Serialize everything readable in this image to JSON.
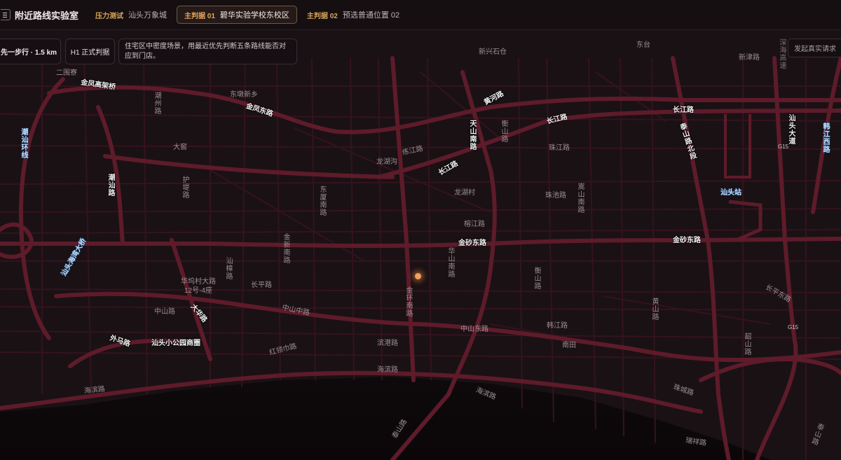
{
  "header": {
    "app_title": "附近路线实验室",
    "chips": [
      {
        "label": "压力测试",
        "value": "汕头万象城"
      },
      {
        "label": "主判据 01",
        "value": "碧华实验学校东校区"
      },
      {
        "label": "主判据 02",
        "value": "预选普通位置 02"
      }
    ]
  },
  "overlay": {
    "mode": "先一步行 · 1.5 km",
    "judge": "H1 正式判据",
    "description": "住宅区中密度场景，用最近优先判断五条路线能否对应到门店。",
    "request_button": "发起真实请求"
  },
  "map": {
    "labels": {
      "xinxing": "新兴石仓",
      "dongtai": "东台",
      "xinjin": "新津路",
      "ertu": "二围寮",
      "jinfeng_gj": "金凤高架桥",
      "dongdun": "东墩新乡",
      "jinfeng_east": "金凤东路",
      "chaoshan_n": "潮州路",
      "huanghe": "黄河路",
      "tianshan": "天山南路",
      "hengshan": "衡山路",
      "changjiang1": "长江路",
      "changjiang2": "长江路",
      "changjiang3": "长江路",
      "taishan": "泰山路北段",
      "tianshan_bridge": "汕头大道",
      "dagan": "大窖",
      "lianjiang": "练江路",
      "longhugou": "龙湖沟",
      "zhujiang": "珠江路",
      "huyang": "护堤路",
      "chaoshan": "潮汕路",
      "guangxia": "光华路",
      "dongxia": "东厦南路",
      "longhucun": "龙湖村",
      "zhuchi": "珠池路",
      "songshan": "嵩山南路",
      "rongjiang": "榕江路",
      "jinxin": "金新南路",
      "jinsha_e1": "金砂东路",
      "jinsha_e2": "金砂东路",
      "huashan": "华山南路",
      "shanzhang": "汕樟路",
      "huawu": "华坞村大路\n12号-4座",
      "changping": "长平路",
      "jinhuan": "金环南路",
      "hengshan2": "衡山路",
      "changping_e": "长平东路",
      "zhongshan": "中山路",
      "dahua": "大华路",
      "zhongshan_m": "中山中路",
      "zhongshan_e": "中山东路",
      "hanjiang": "韩江路",
      "huangshan": "黄山路",
      "waima": "外马路",
      "xiaogongyuan": "汕头小公园商圈",
      "hongling": "红领巾路",
      "bingang": "滨港路",
      "nantian": "南田",
      "shaoshan": "韶山路",
      "haibin1": "海滨路",
      "haibin2": "海滨路",
      "haibin3": "海滨路",
      "zhucheng": "珠城路",
      "tuoxian": "汕头站",
      "g15a": "G15",
      "g15b": "G15",
      "shenhai": "深海高速",
      "chaoshan_hw": "潮汕环线",
      "jingan": "韩江西路",
      "jin_bridge": "汕头海湾大桥",
      "taishan_s": "泰山路",
      "yanjiang": "瑞祥路",
      "xinjin2": "新津路",
      "huanghe2": "泰山路"
    }
  },
  "colors": {
    "background": "#140d10",
    "road_major": "#5e1b2a",
    "road_minor": "#3a1520",
    "accent": "#e8a55c",
    "marker": "#f2a05a"
  }
}
